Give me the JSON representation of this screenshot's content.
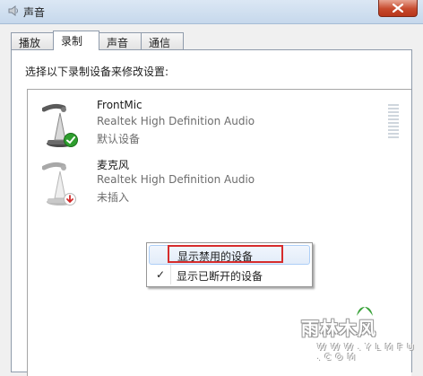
{
  "window": {
    "title": "声音",
    "close_icon": "close-icon",
    "colors": {
      "titlebar": "#c6d8ec",
      "close": "#c74a2d"
    }
  },
  "tabs": [
    {
      "label": "播放",
      "active": false
    },
    {
      "label": "录制",
      "active": true
    },
    {
      "label": "声音",
      "active": false
    },
    {
      "label": "通信",
      "active": false
    }
  ],
  "panel": {
    "instruction": "选择以下录制设备来修改设置:"
  },
  "devices": [
    {
      "name": "FrontMic",
      "driver": "Realtek High Definition Audio",
      "status": "默认设备",
      "icon": "microphone-icon",
      "badge_icon": "green-check-icon"
    },
    {
      "name": "麦克风",
      "driver": "Realtek High Definition Audio",
      "status": "未插入",
      "icon": "microphone-icon",
      "badge_icon": "red-down-arrow-icon"
    }
  ],
  "context_menu": {
    "items": [
      {
        "label": "显示禁用的设备",
        "checked": false,
        "highlighted": true
      },
      {
        "label": "显示已断开的设备",
        "checked": true,
        "check_mark": "✓"
      }
    ],
    "highlight_color": "#d62c2c"
  },
  "watermark": {
    "text": "雨林木风",
    "url": "W W W . Y L M F U . C O M"
  }
}
